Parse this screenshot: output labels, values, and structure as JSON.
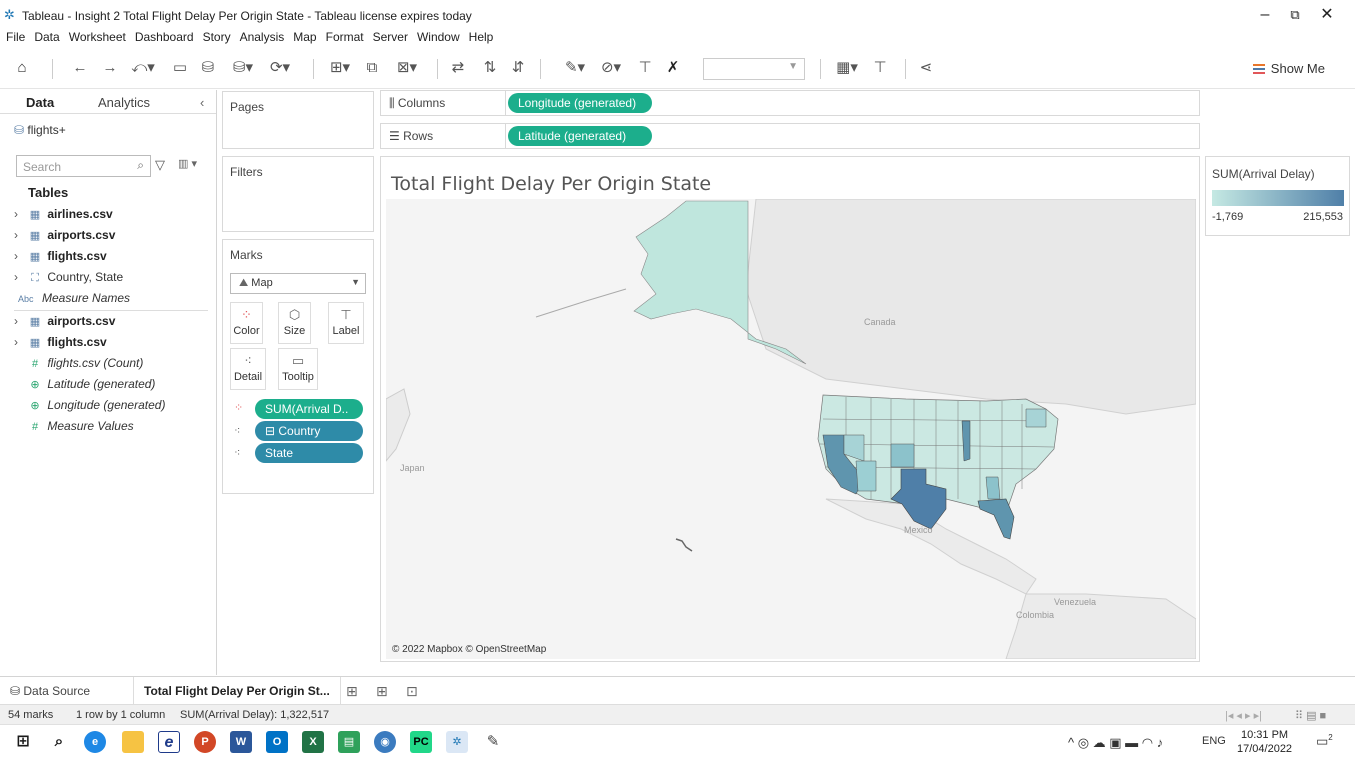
{
  "window": {
    "title": "Tableau - Insight 2 Total Flight Delay Per Origin State - Tableau license expires today",
    "minimize": "–",
    "maximize": "⧉",
    "close": "✕"
  },
  "menu": [
    "File",
    "Data",
    "Worksheet",
    "Dashboard",
    "Story",
    "Analysis",
    "Map",
    "Format",
    "Server",
    "Window",
    "Help"
  ],
  "toolbar": {
    "show_me": "Show Me"
  },
  "left_pane": {
    "tab_data": "Data",
    "tab_analytics": "Analytics",
    "collapse": "‹",
    "datasource": "flights+",
    "search_placeholder": "Search",
    "tables_heading": "Tables",
    "fields": [
      {
        "label": "airlines.csv"
      },
      {
        "label": "airports.csv"
      },
      {
        "label": "flights.csv"
      },
      {
        "label": "Country, State"
      },
      {
        "label": "Measure Names",
        "type": "Abc"
      },
      {
        "label": "airports.csv"
      },
      {
        "label": "flights.csv"
      },
      {
        "label": "flights.csv (Count)",
        "type": "#"
      },
      {
        "label": "Latitude (generated)"
      },
      {
        "label": "Longitude (generated)"
      },
      {
        "label": "Measure Values",
        "type": "#"
      }
    ]
  },
  "cards": {
    "pages": "Pages",
    "filters": "Filters",
    "marks": "Marks",
    "mark_type": "Map",
    "buttons": [
      "Color",
      "Size",
      "Label",
      "Detail",
      "Tooltip"
    ],
    "pills": [
      "SUM(Arrival D..",
      "Country",
      "State"
    ]
  },
  "shelves": {
    "columns_label": "Columns",
    "columns_pill": "Longitude (generated)",
    "rows_label": "Rows",
    "rows_pill": "Latitude (generated)"
  },
  "viz": {
    "title": "Total Flight Delay Per Origin State",
    "credit": "© 2022 Mapbox © OpenStreetMap",
    "labels": [
      "Canada",
      "Japan",
      "Mexico",
      "Venezuela",
      "Colombia"
    ]
  },
  "legend": {
    "title": "SUM(Arrival Delay)",
    "min": "-1,769",
    "max": "215,553",
    "color_low": "#c5e9e3",
    "color_high": "#4f7fa8"
  },
  "sheetbar": {
    "data_source": "Data Source",
    "sheet": "Total Flight Delay Per Origin St..."
  },
  "status": {
    "marks": "54 marks",
    "rows_cols": "1 row by 1 column",
    "sum": "SUM(Arrival Delay): 1,322,517"
  },
  "taskbar": {
    "lang": "ENG",
    "time": "10:31 PM",
    "date": "17/04/2022",
    "notif": "2"
  }
}
